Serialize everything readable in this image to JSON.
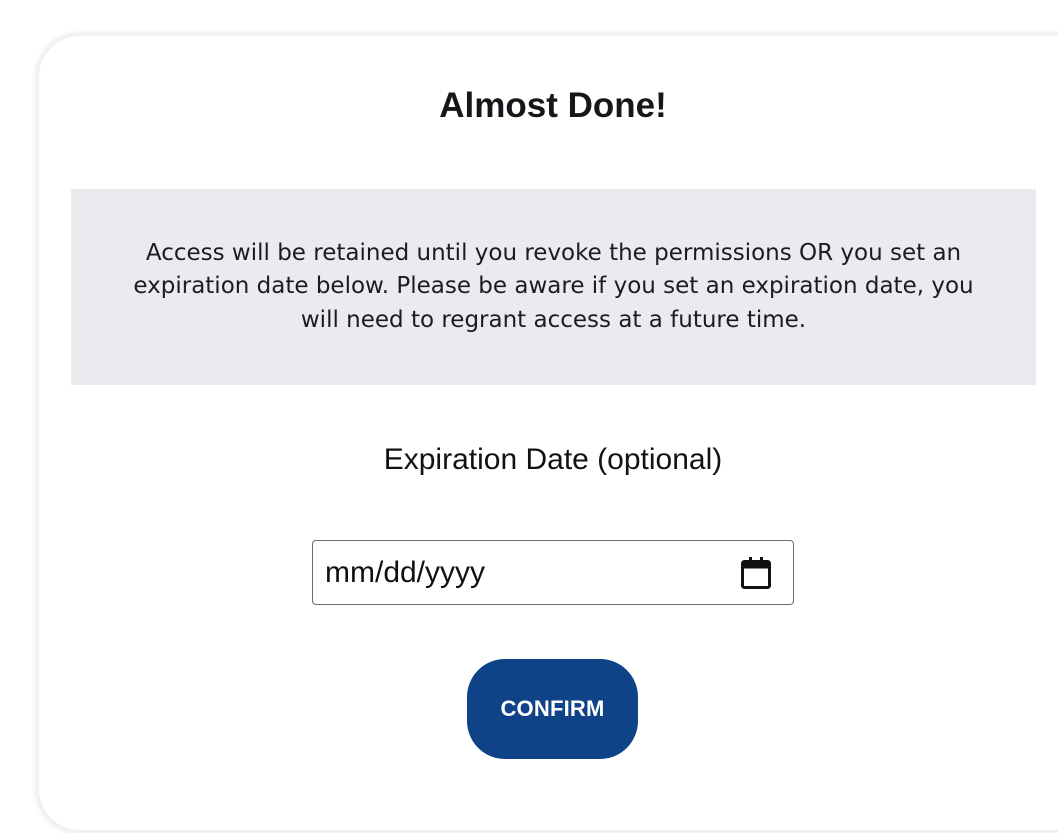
{
  "dialog": {
    "title": "Almost Done!",
    "notice": "Access will be retained until you revoke the permissions OR you set an expiration date below. Please be aware if you set an expiration date, you will need to regrant access at a future time.",
    "expiration_label": "Expiration Date (optional)",
    "date_input": {
      "placeholder": "mm/dd/yyyy",
      "icon": "calendar-icon"
    },
    "confirm_label": "CONFIRM"
  },
  "colors": {
    "accent": "#0f4387",
    "notice_bg": "#ebebef"
  }
}
